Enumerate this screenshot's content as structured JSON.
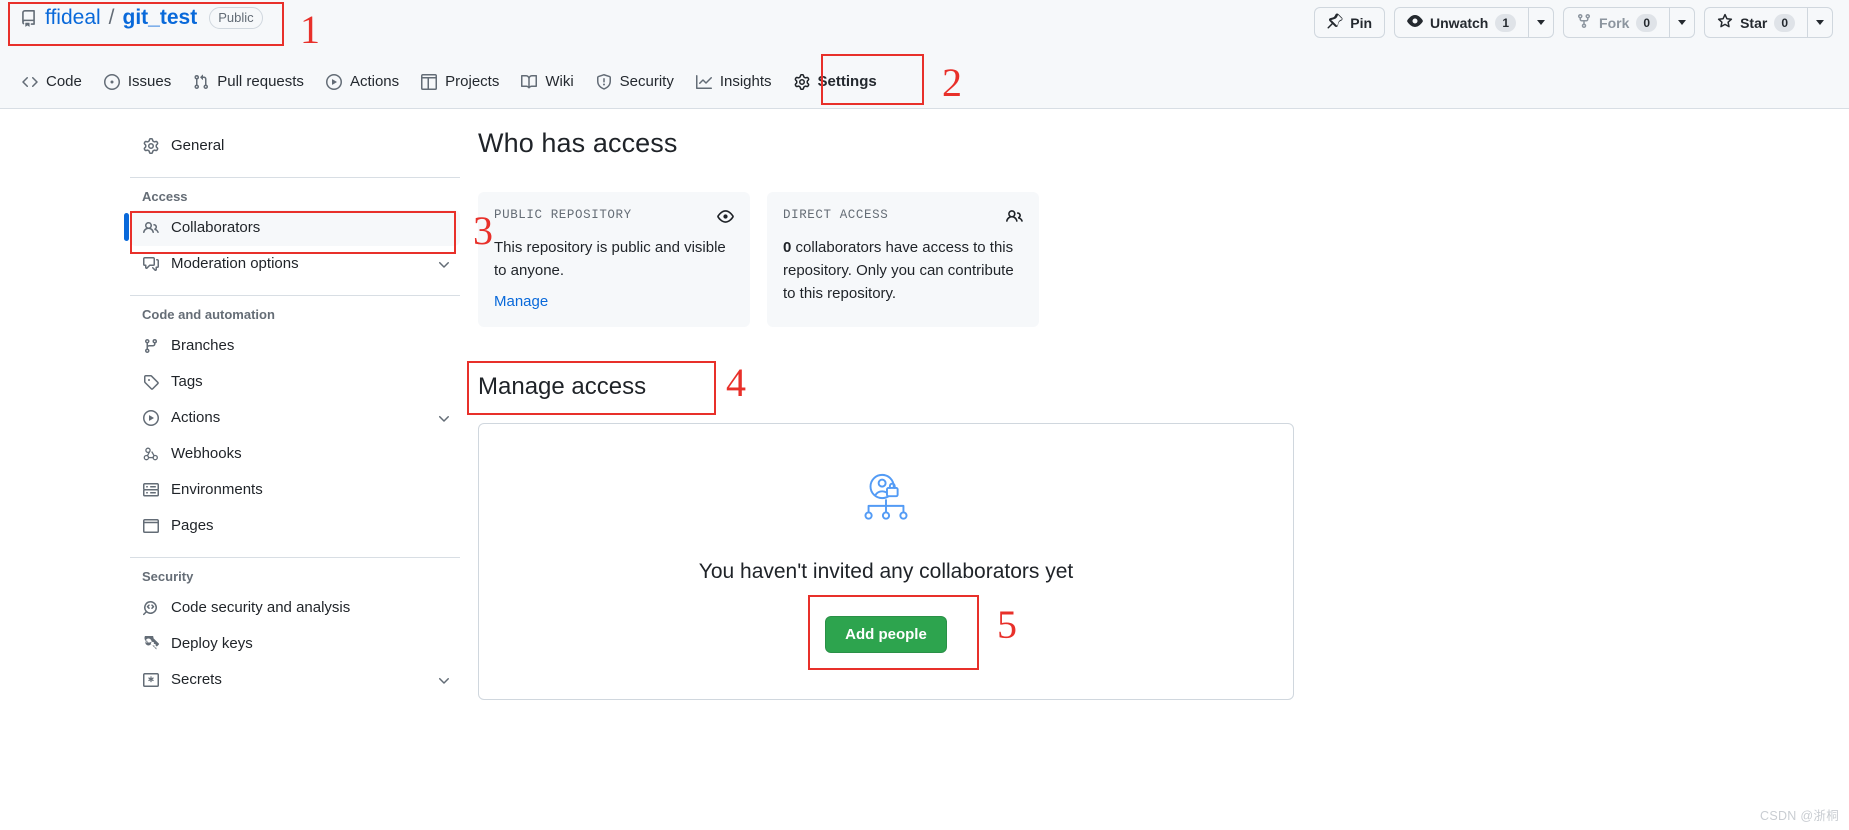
{
  "header": {
    "repo_icon": "repo-icon",
    "owner": "ffideal",
    "separator": "/",
    "repo": "git_test",
    "visibility": "Public",
    "actions": {
      "pin": "Pin",
      "unwatch": "Unwatch",
      "unwatch_count": "1",
      "fork": "Fork",
      "fork_count": "0",
      "star": "Star",
      "star_count": "0"
    }
  },
  "nav": {
    "tabs": [
      {
        "label": "Code",
        "icon": "code-icon",
        "selected": false
      },
      {
        "label": "Issues",
        "icon": "issue-opened-icon",
        "selected": false
      },
      {
        "label": "Pull requests",
        "icon": "git-pull-request-icon",
        "selected": false
      },
      {
        "label": "Actions",
        "icon": "play-icon",
        "selected": false
      },
      {
        "label": "Projects",
        "icon": "table-icon",
        "selected": false
      },
      {
        "label": "Wiki",
        "icon": "book-icon",
        "selected": false
      },
      {
        "label": "Security",
        "icon": "shield-icon",
        "selected": false
      },
      {
        "label": "Insights",
        "icon": "graph-icon",
        "selected": false
      },
      {
        "label": "Settings",
        "icon": "gear-icon",
        "selected": true
      }
    ]
  },
  "sidebar": {
    "general": {
      "label": "General",
      "icon": "gear-icon"
    },
    "access_group": "Access",
    "access_items": [
      {
        "label": "Collaborators",
        "icon": "people-icon",
        "active": true,
        "chevron": false
      },
      {
        "label": "Moderation options",
        "icon": "comment-discussion-icon",
        "active": false,
        "chevron": true
      }
    ],
    "code_group": "Code and automation",
    "code_items": [
      {
        "label": "Branches",
        "icon": "git-branch-icon",
        "chevron": false
      },
      {
        "label": "Tags",
        "icon": "tag-icon",
        "chevron": false
      },
      {
        "label": "Actions",
        "icon": "play-icon",
        "chevron": true
      },
      {
        "label": "Webhooks",
        "icon": "webhook-icon",
        "chevron": false
      },
      {
        "label": "Environments",
        "icon": "server-icon",
        "chevron": false
      },
      {
        "label": "Pages",
        "icon": "browser-icon",
        "chevron": false
      }
    ],
    "security_group": "Security",
    "security_items": [
      {
        "label": "Code security and analysis",
        "icon": "code-search-icon",
        "chevron": false
      },
      {
        "label": "Deploy keys",
        "icon": "key-icon",
        "chevron": false
      },
      {
        "label": "Secrets",
        "icon": "asterisk-icon",
        "chevron": true
      }
    ]
  },
  "main": {
    "heading": "Who has access",
    "cards": [
      {
        "kicker": "PUBLIC REPOSITORY",
        "icon": "eye-icon",
        "body": "This repository is public and visible to anyone.",
        "link": "Manage"
      },
      {
        "kicker": "DIRECT ACCESS",
        "icon": "people-icon",
        "body_strong": "0",
        "body": "collaborators have access to this repository. Only you can contribute to this repository."
      }
    ],
    "manage_access_heading": "Manage access",
    "empty_state": {
      "illustration": "collaborator-lock-illustration",
      "title": "You haven't invited any collaborators yet",
      "button": "Add people"
    }
  },
  "annotations": {
    "numbers": [
      "1",
      "2",
      "3",
      "4",
      "5"
    ],
    "color": "#e8302a"
  },
  "watermark": "CSDN @浙桐"
}
